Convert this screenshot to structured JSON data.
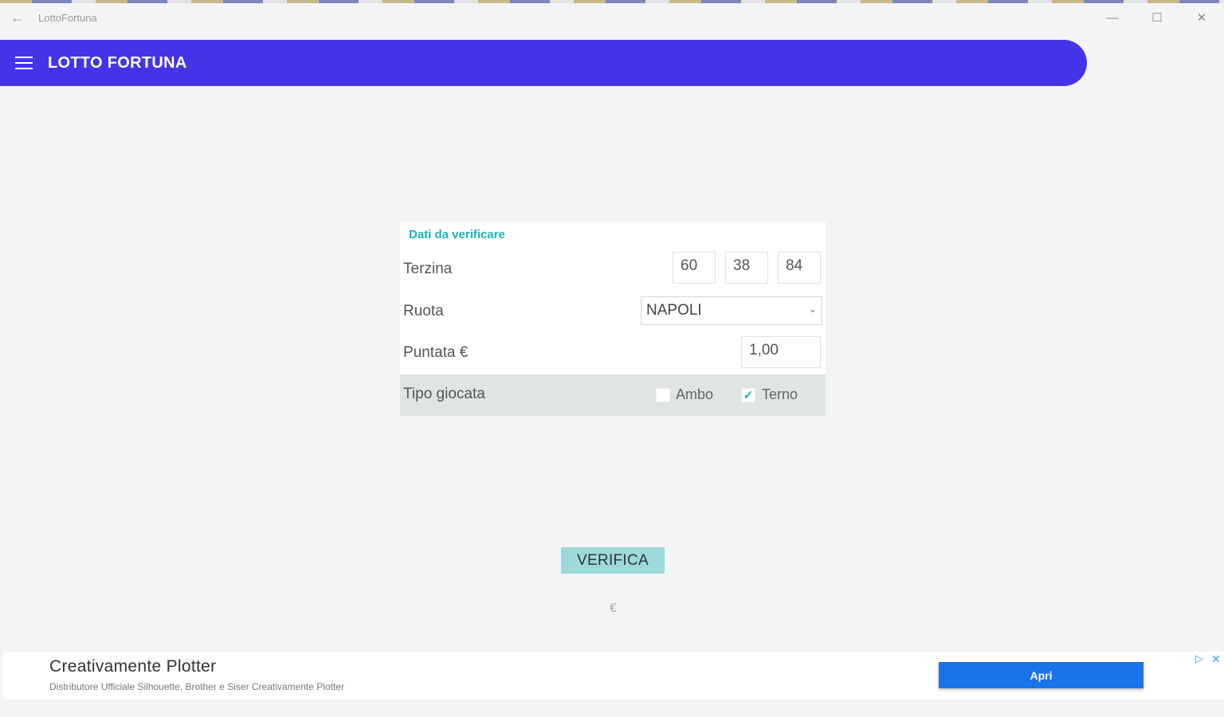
{
  "window": {
    "title": "LottoFortuna",
    "back_icon": "←",
    "minimize_icon": "—",
    "maximize_icon": "☐",
    "close_icon": "✕"
  },
  "appbar": {
    "title": "LOTTO FORTUNA",
    "color": "#4434e8"
  },
  "form": {
    "header": "Dati da verificare",
    "terzina_label": "Terzina",
    "terzina_values": [
      "60",
      "38",
      "84"
    ],
    "ruota_label": "Ruota",
    "ruota_value": "NAPOLI",
    "puntata_label": "Puntata €",
    "puntata_value": "1,00",
    "tipo_label": "Tipo giocata",
    "options": [
      {
        "label": "Ambo",
        "checked": false
      },
      {
        "label": "Terno",
        "checked": true
      }
    ]
  },
  "actions": {
    "verify_label": "VERIFICA",
    "result_text": "€"
  },
  "ad": {
    "title": "Creativamente Plotter",
    "description": "Distributore Ufficiale Silhouette, Brother e Siser Creativamente Plotter",
    "cta": "Apri",
    "choices_icon": "▷",
    "close_icon": "✕"
  },
  "colors": {
    "accent": "#1fb3b3",
    "button": "#9dd9d9",
    "ad_button": "#1a73e8"
  }
}
